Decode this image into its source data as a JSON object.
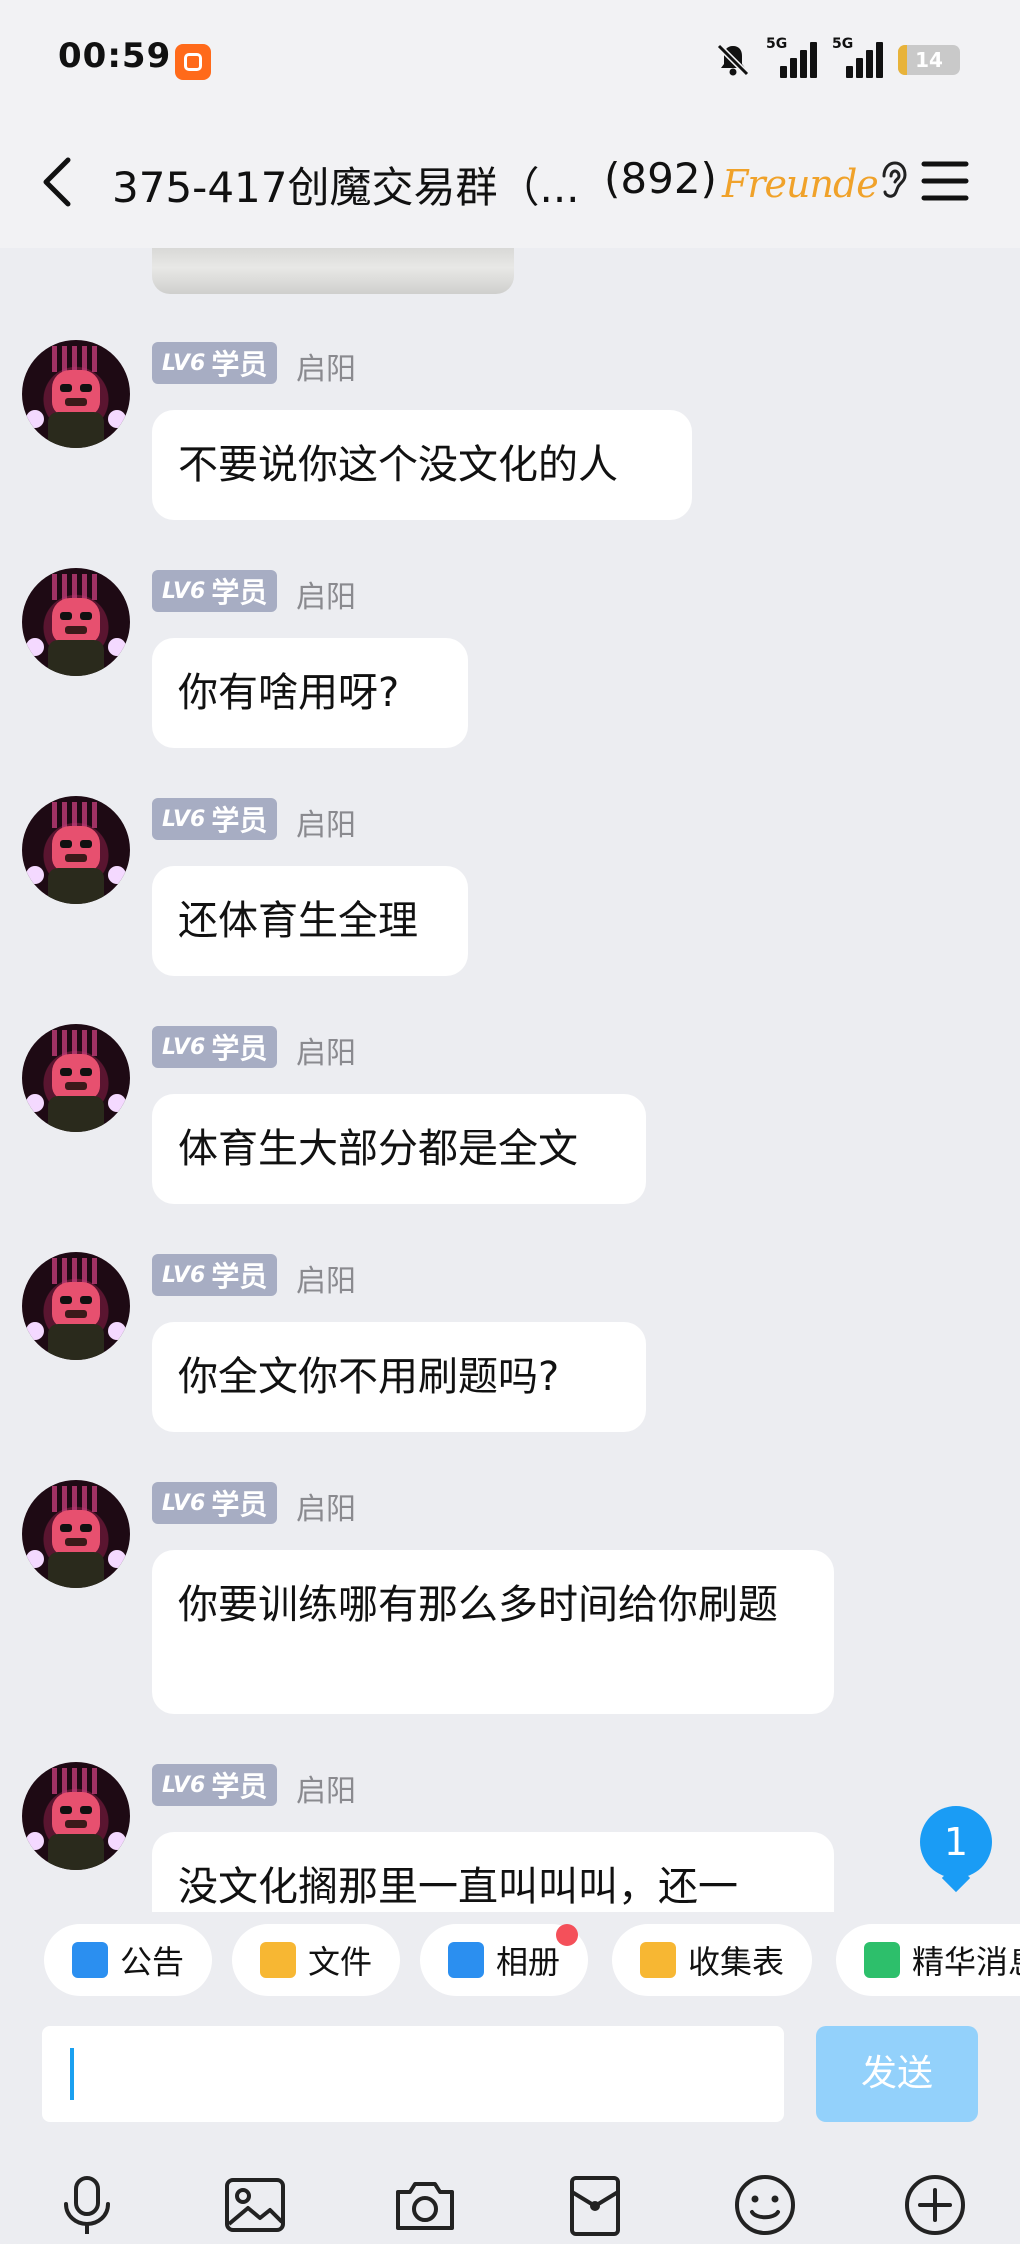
{
  "status": {
    "time": "00:59",
    "network_1": "5G",
    "network_2": "5G",
    "battery": "14",
    "battery_percent": 14
  },
  "header": {
    "title": "375-417创魔交易群（...",
    "member_count": "(892)",
    "brand_text": "Freunde"
  },
  "messages": [
    {
      "level": "LV6",
      "role": "学员",
      "sender": "启阳",
      "text": "不要说你这个没文化的人"
    },
    {
      "level": "LV6",
      "role": "学员",
      "sender": "启阳",
      "text": "你有啥用呀?"
    },
    {
      "level": "LV6",
      "role": "学员",
      "sender": "启阳",
      "text": "还体育生全理"
    },
    {
      "level": "LV6",
      "role": "学员",
      "sender": "启阳",
      "text": "体育生大部分都是全文"
    },
    {
      "level": "LV6",
      "role": "学员",
      "sender": "启阳",
      "text": "你全文你不用刷题吗?"
    },
    {
      "level": "LV6",
      "role": "学员",
      "sender": "启阳",
      "text": "你要训练哪有那么多时间给你刷题"
    },
    {
      "level": "LV6",
      "role": "学员",
      "sender": "启阳",
      "text": "没文化搁那里一直叫叫叫，还一"
    }
  ],
  "unread_count": "1",
  "quick_bar": [
    {
      "label": "公告",
      "icon": "announcement-icon",
      "color": "#2b8ff0"
    },
    {
      "label": "文件",
      "icon": "folder-icon",
      "color": "#f7b733"
    },
    {
      "label": "相册",
      "icon": "album-icon",
      "color": "#2b8ff0"
    },
    {
      "label": "收集表",
      "icon": "form-icon",
      "color": "#f7b733"
    },
    {
      "label": "精华消息",
      "icon": "essence-icon",
      "color": "#2dbf6b"
    }
  ],
  "composer": {
    "value": "",
    "send_label": "发送"
  },
  "colors": {
    "accent": "#1a9cf5",
    "send_disabled": "#93d1fb",
    "badge_bg": "#a7adc3",
    "background": "#ecedf1"
  }
}
